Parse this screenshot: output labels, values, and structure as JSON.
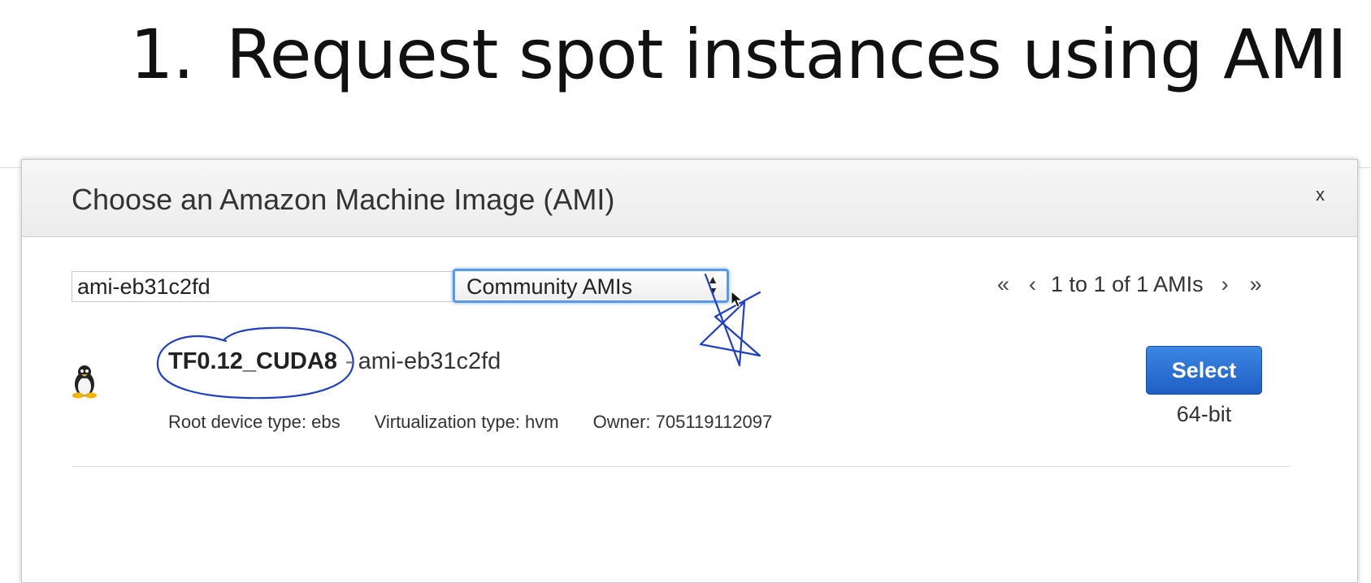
{
  "slide": {
    "title_number": "1.",
    "title_text": "Request spot instances using AMI"
  },
  "modal": {
    "title": "Choose an Amazon Machine Image (AMI)",
    "close_label": "x",
    "search": {
      "value": "ami-eb31c2fd"
    },
    "filter_select": {
      "selected": "Community AMIs"
    },
    "pager": {
      "first": "«",
      "prev": "‹",
      "range_text": "1 to 1 of 1 AMIs",
      "next": "›",
      "last": "»"
    },
    "results": [
      {
        "name": "TF0.12_CUDA8",
        "separator": "-",
        "ami_id": "ami-eb31c2fd",
        "root_device": "Root device type: ebs",
        "virtualization": "Virtualization type: hvm",
        "owner": "Owner: 705119112097",
        "select_label": "Select",
        "arch": "64-bit",
        "os_icon": "linux-penguin-icon"
      }
    ]
  },
  "colors": {
    "select_button": "#2a6fd6",
    "annotation_ink": "#1e3fc8",
    "select_focus": "#5a9ae8"
  }
}
